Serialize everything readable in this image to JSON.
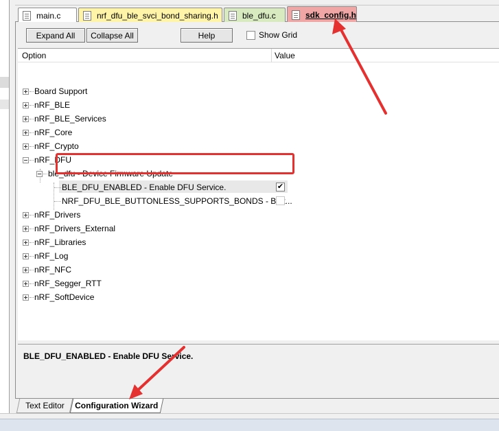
{
  "editor_tabs": [
    {
      "label": "main.c",
      "color": "#ffffff"
    },
    {
      "label": "nrf_dfu_ble_svci_bond_sharing.h",
      "color": "#fff4a8"
    },
    {
      "label": "ble_dfu.c",
      "color": "#d8ebc0"
    },
    {
      "label": "sdk_config.h",
      "color": "#f1a6a6",
      "active": true
    }
  ],
  "toolbar": {
    "expand_all": "Expand All",
    "collapse_all": "Collapse All",
    "help": "Help",
    "show_grid": "Show Grid",
    "show_grid_checked": false
  },
  "tree": {
    "header_option": "Option",
    "header_value": "Value",
    "items": [
      {
        "label": "Board Support"
      },
      {
        "label": "nRF_BLE"
      },
      {
        "label": "nRF_BLE_Services"
      },
      {
        "label": "nRF_Core"
      },
      {
        "label": "nRF_Crypto"
      },
      {
        "label": "nRF_DFU"
      },
      {
        "label": "ble_dfu - Device Firmware Update"
      },
      {
        "label": "BLE_DFU_ENABLED  - Enable DFU Service.",
        "checked": true
      },
      {
        "label": "NRF_DFU_BLE_BUTTONLESS_SUPPORTS_BONDS  - Butt...",
        "checked": false
      },
      {
        "label": "nRF_Drivers"
      },
      {
        "label": "nRF_Drivers_External"
      },
      {
        "label": "nRF_Libraries"
      },
      {
        "label": "nRF_Log"
      },
      {
        "label": "nRF_NFC"
      },
      {
        "label": "nRF_Segger_RTT"
      },
      {
        "label": "nRF_SoftDevice"
      }
    ]
  },
  "description": "BLE_DFU_ENABLED  - Enable DFU Service.",
  "bottom_tabs": [
    {
      "label": "Text Editor"
    },
    {
      "label": "Configuration Wizard",
      "active": true
    }
  ],
  "annotation_color": "#e53030"
}
